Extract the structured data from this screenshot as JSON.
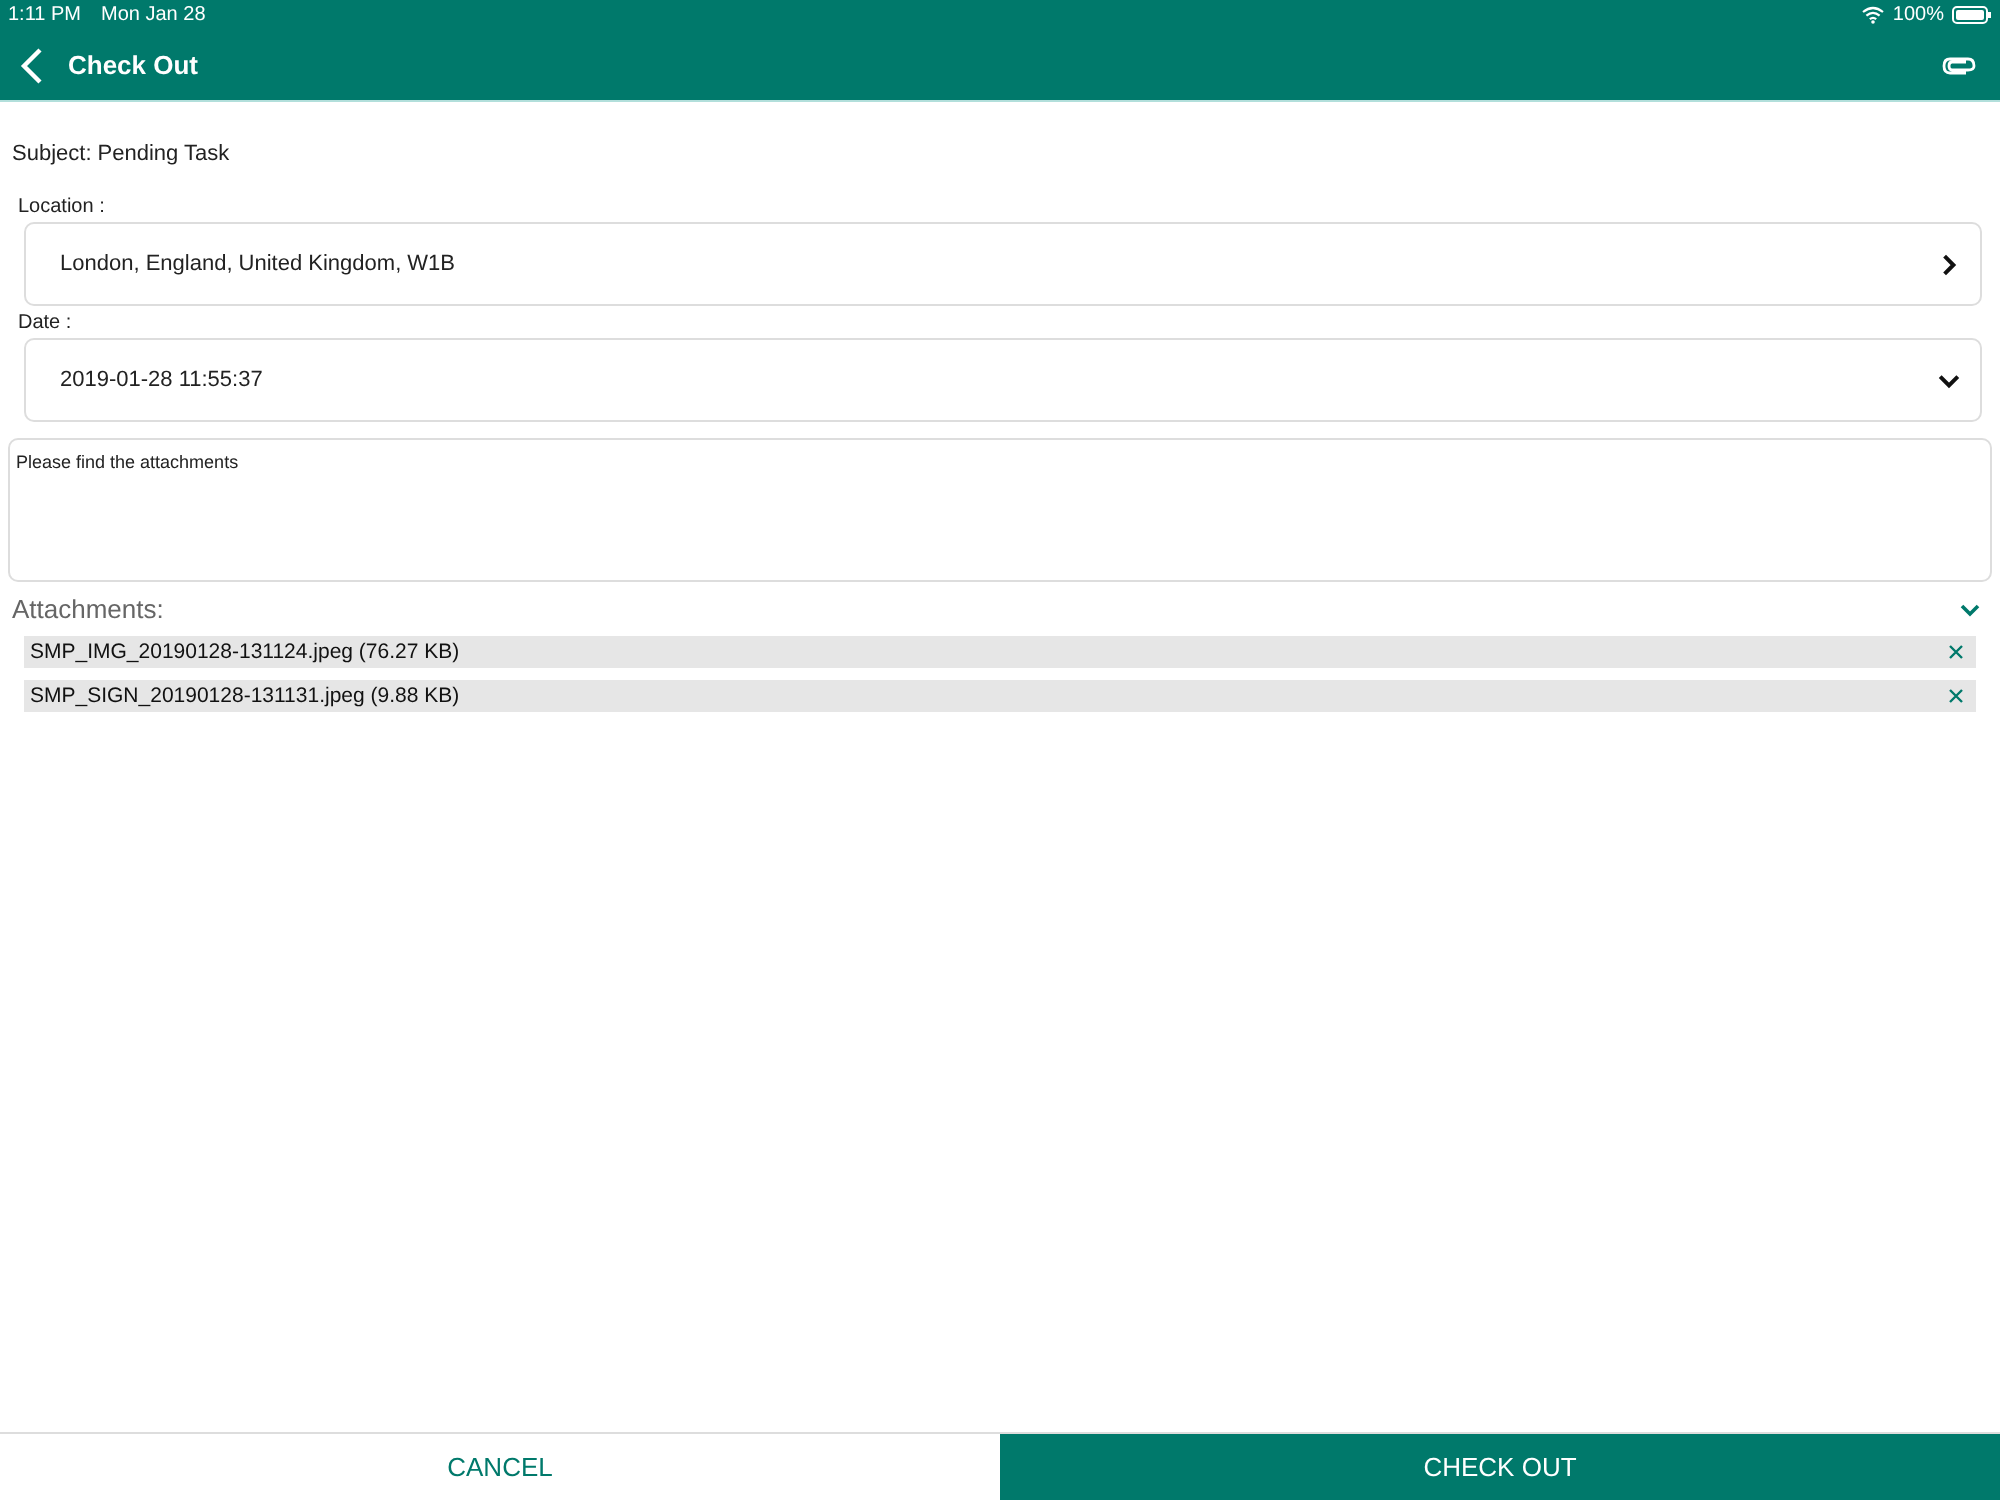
{
  "status_bar": {
    "time": "1:11 PM",
    "date": "Mon Jan 28",
    "battery": "100%"
  },
  "nav_bar": {
    "title": "Check Out"
  },
  "subject": "Subject: Pending Task",
  "fields": [
    {
      "label": "Location :",
      "value": "London, England, United Kingdom, W1B",
      "kind": "link"
    },
    {
      "label": "Date :",
      "value": "2019-01-28 11:55:37",
      "kind": "dropdown"
    }
  ],
  "note": {
    "value": "Please find the attachments"
  },
  "attachments": {
    "title": "Attachments:",
    "expanded": true,
    "items": [
      {
        "name": "SMP_IMG_20190128-131124.jpeg (76.27 KB)"
      },
      {
        "name": "SMP_SIGN_20190128-131131.jpeg (9.88 KB)"
      }
    ]
  },
  "buttons": [
    {
      "label": "CANCEL",
      "kind": "secondary"
    },
    {
      "label": "CHECK OUT",
      "kind": "primary"
    }
  ]
}
